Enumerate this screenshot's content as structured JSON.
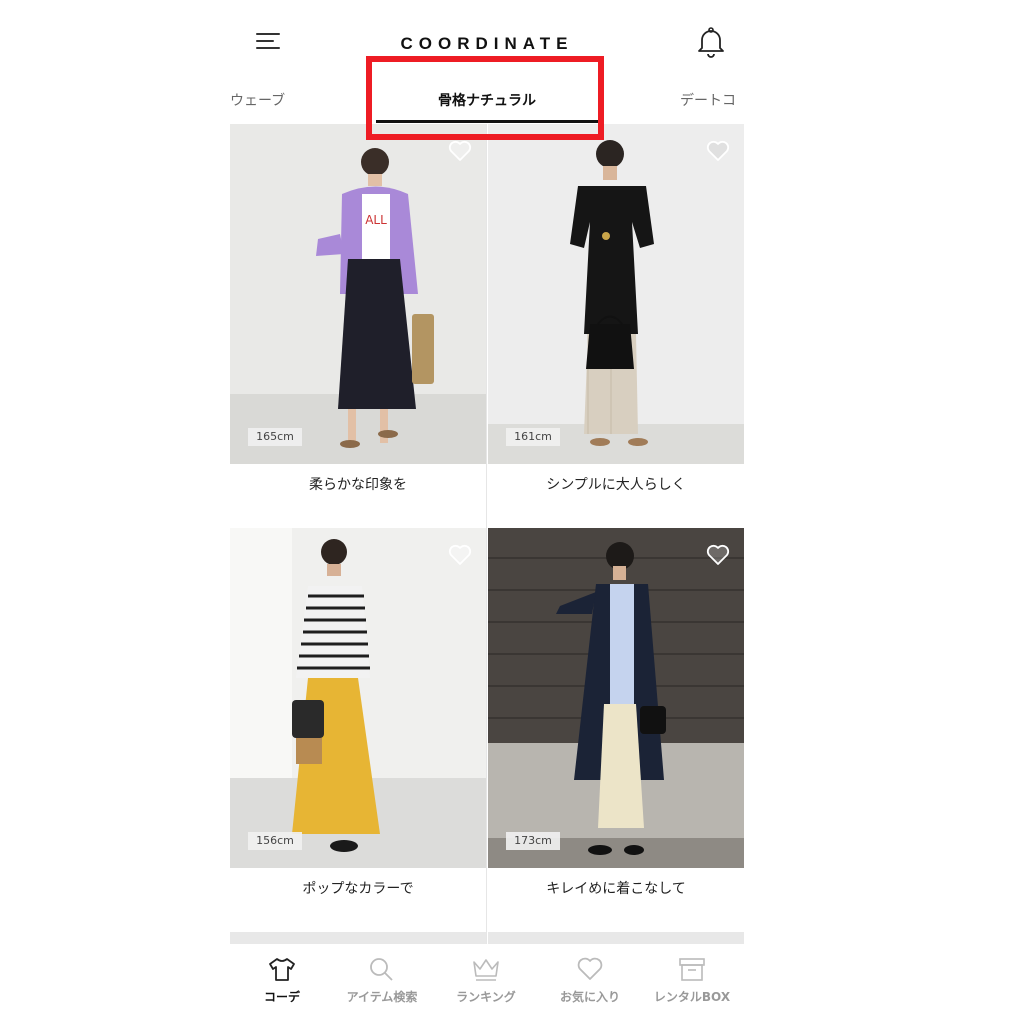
{
  "header": {
    "title": "COORDINATE"
  },
  "tabs": [
    {
      "label": "ウェーブ"
    },
    {
      "label": "骨格ナチュラル",
      "active": true
    },
    {
      "label": "デートコ"
    }
  ],
  "cards": [
    {
      "height": "165cm",
      "caption": "柔らかな印象を"
    },
    {
      "height": "161cm",
      "caption": "シンプルに大人らしく"
    },
    {
      "height": "156cm",
      "caption": "ポップなカラーで"
    },
    {
      "height": "173cm",
      "caption": "キレイめに着こなして"
    }
  ],
  "bottom_nav": [
    {
      "label": "コーデ",
      "icon": "tshirt-icon",
      "active": true
    },
    {
      "label": "アイテム検索",
      "icon": "search-icon"
    },
    {
      "label": "ランキング",
      "icon": "crown-icon"
    },
    {
      "label": "お気に入り",
      "icon": "heart-icon"
    },
    {
      "label": "レンタルBOX",
      "icon": "box-icon"
    }
  ],
  "colors": {
    "highlight": "#ee1c24",
    "active_text": "#111111",
    "inactive_text": "#999999"
  }
}
